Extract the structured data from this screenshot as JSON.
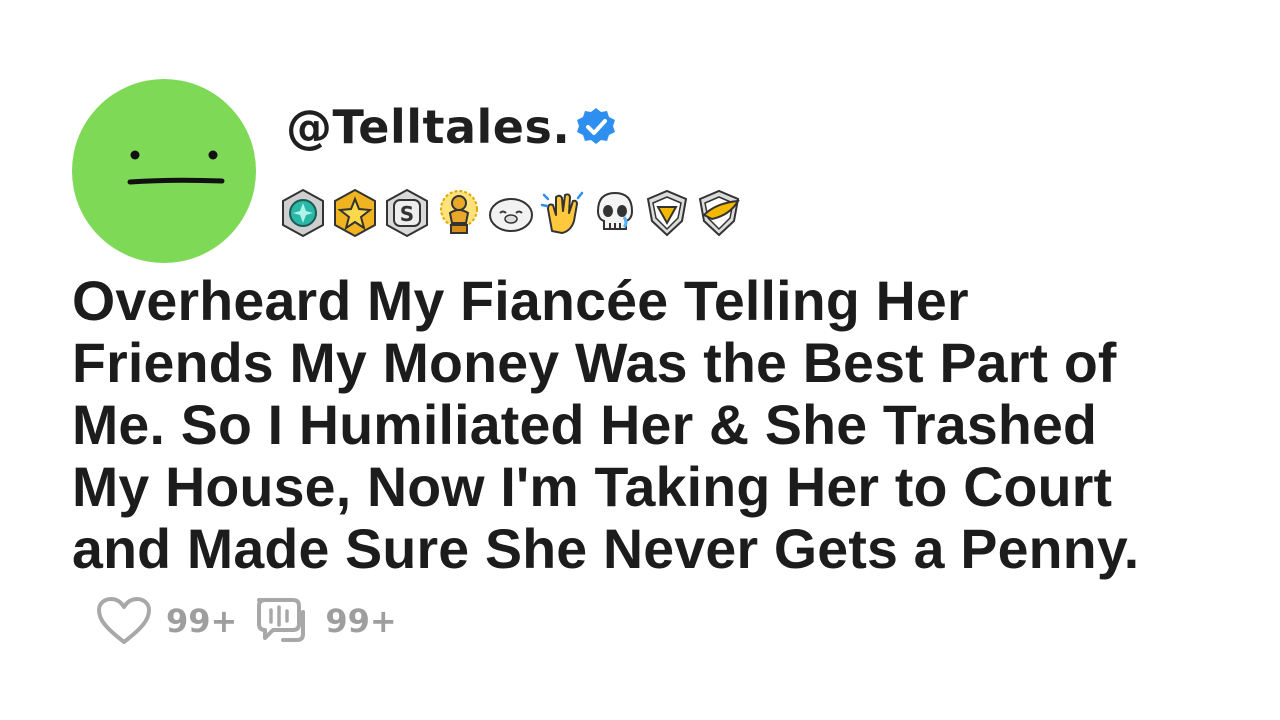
{
  "post": {
    "username": "@Telltales.",
    "verified": true,
    "avatar_color": "#7ed957",
    "badges": [
      "gem-badge",
      "star-badge",
      "s-badge",
      "trophy-badge",
      "seal-badge",
      "clapping-hands-badge",
      "skull-badge",
      "heart-shield-badge",
      "wing-shield-badge"
    ],
    "title_lines": [
      "Overheard My Fiancée Telling Her",
      "Friends My Money Was the Best Part of",
      "Me. So I Humiliated Her & She Trashed",
      "My House, Now I'm Taking Her to Court",
      "and Made Sure She Never Gets a Penny."
    ],
    "likes": "99+",
    "comments": "99+"
  }
}
